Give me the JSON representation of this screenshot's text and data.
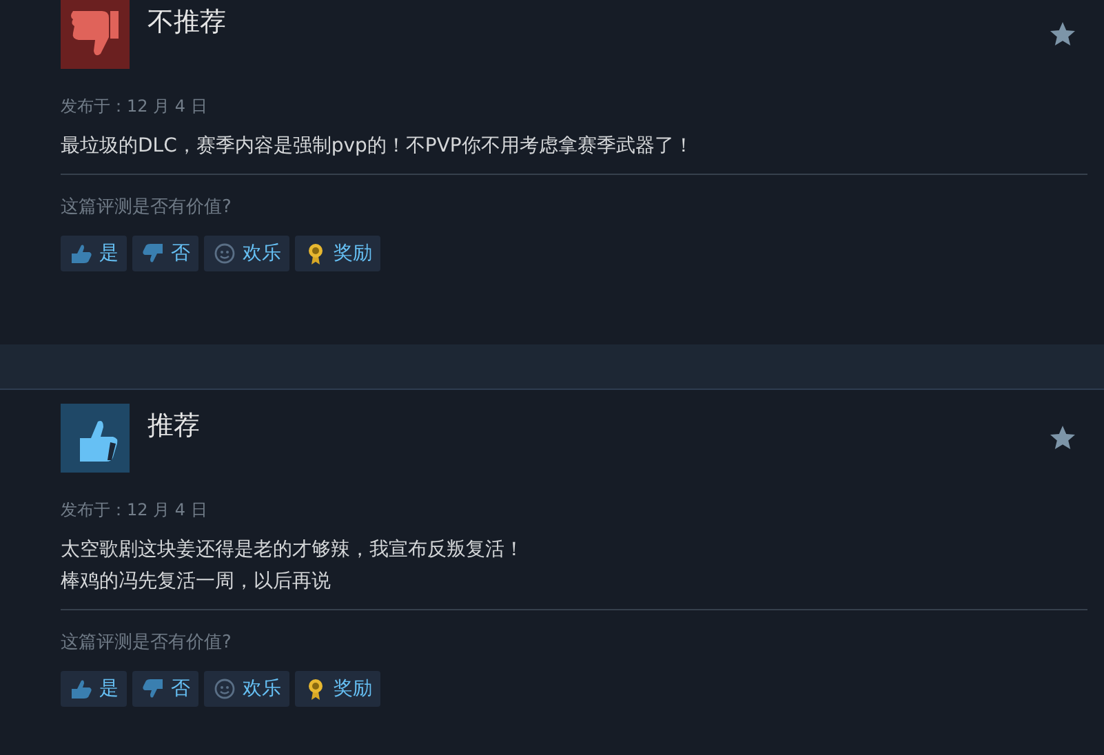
{
  "reviews": [
    {
      "kind": "not_recommended",
      "verdict": "不推荐",
      "date": "发布于：12 月 4 日",
      "lines": [
        "最垃圾的DLC，赛季内容是强制pvp的！不PVP你不用考虑拿赛季武器了！"
      ],
      "question": "这篇评测是否有价值?",
      "buttons": [
        {
          "kind": "yes",
          "label": "是"
        },
        {
          "kind": "no",
          "label": "否"
        },
        {
          "kind": "funny",
          "label": "欢乐"
        },
        {
          "kind": "award",
          "label": "奖励"
        }
      ]
    },
    {
      "kind": "recommended",
      "verdict": "推荐",
      "date": "发布于：12 月 4 日",
      "lines": [
        "太空歌剧这块姜还得是老的才够辣，我宣布反叛复活！",
        "棒鸡的冯先复活一周，以后再说"
      ],
      "question": "这篇评测是否有价值?",
      "buttons": [
        {
          "kind": "yes",
          "label": "是"
        },
        {
          "kind": "no",
          "label": "否"
        },
        {
          "kind": "funny",
          "label": "欢乐"
        },
        {
          "kind": "award",
          "label": "奖励"
        }
      ]
    }
  ]
}
